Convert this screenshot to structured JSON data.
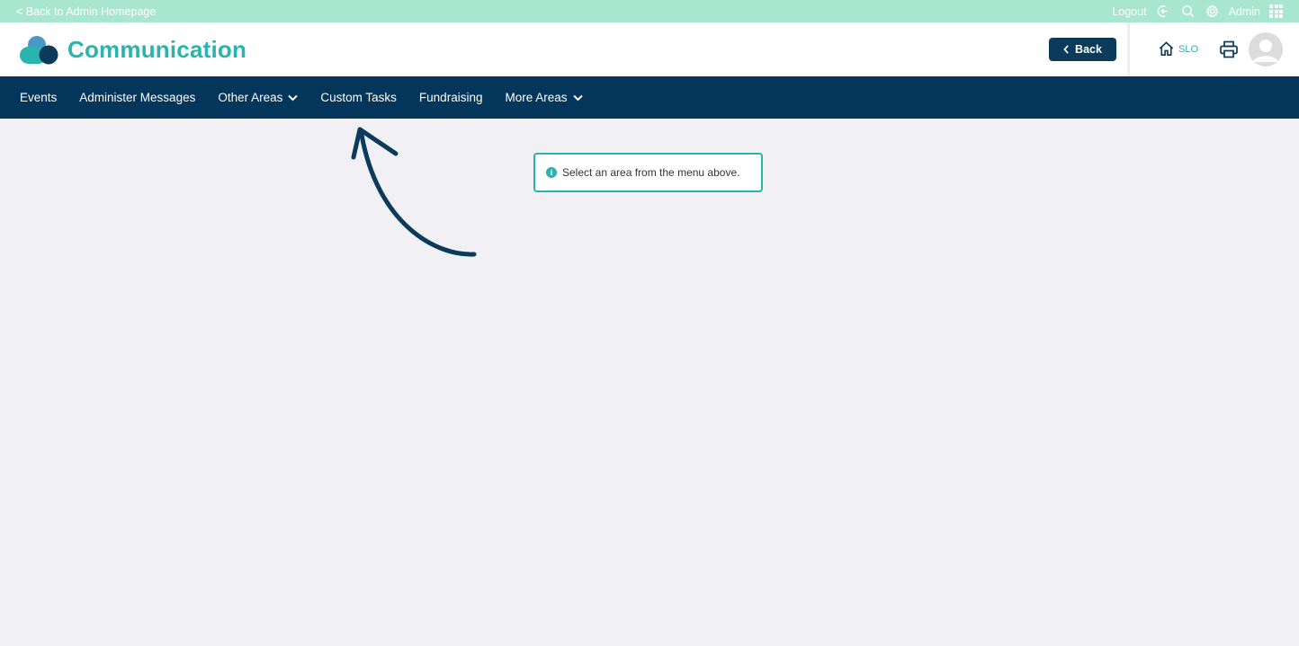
{
  "topbar": {
    "back_link": "< Back to Admin Homepage",
    "logout": "Logout",
    "admin": "Admin",
    "icons": [
      "logout-icon",
      "search-icon",
      "gear-icon",
      "apps-grid-icon"
    ]
  },
  "header": {
    "title": "Communication",
    "back_button": "Back",
    "home_label": "SLO",
    "icons": [
      "logo-icon",
      "chevron-left-icon",
      "home-icon",
      "print-icon",
      "avatar-icon"
    ]
  },
  "nav": {
    "items": [
      {
        "label": "Events"
      },
      {
        "label": "Administer Messages"
      },
      {
        "label": "Other Areas"
      },
      {
        "label": "Custom Tasks"
      },
      {
        "label": "Fundraising"
      },
      {
        "label": "More Areas"
      }
    ]
  },
  "main": {
    "info_message": "Select an area from the menu above.",
    "info_icon": "i"
  },
  "colors": {
    "topbar": "#a8e6cf",
    "brand": "#2bb3ad",
    "navy": "#04355a",
    "button": "#0b3a5b",
    "background": "#f0f0f5"
  }
}
